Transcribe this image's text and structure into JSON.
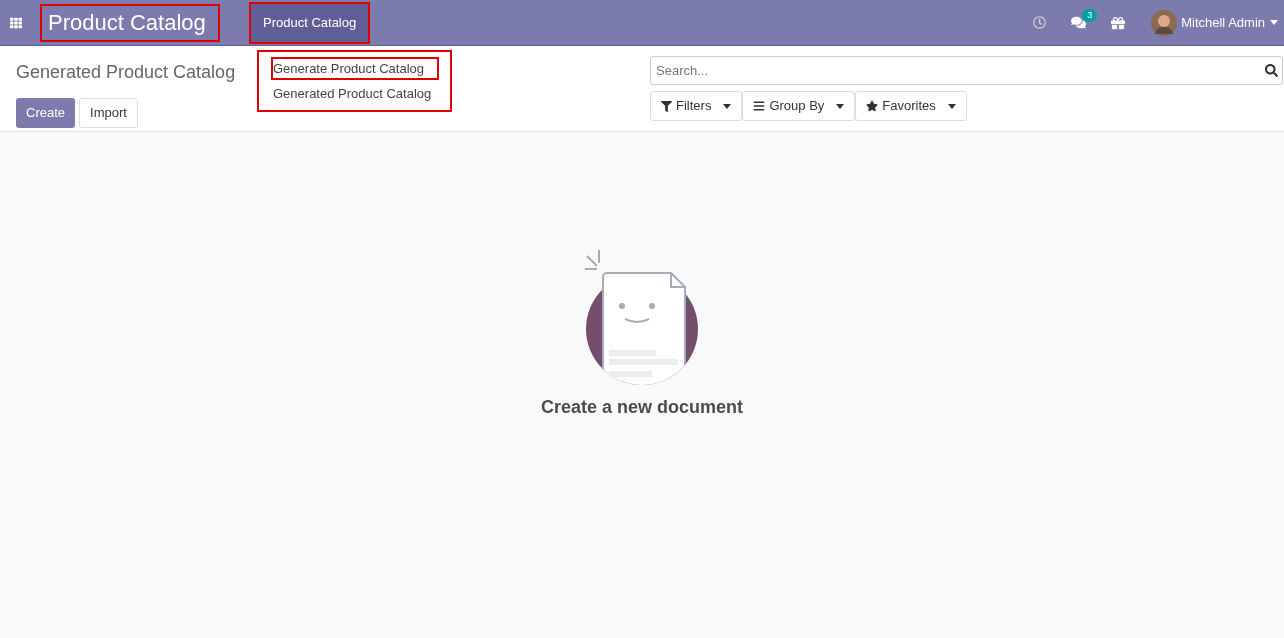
{
  "navbar": {
    "app_title": {
      "text": "Product Catalog",
      "highlighted": true
    },
    "menus": [
      {
        "label": "Product Catalog",
        "open": true,
        "highlighted": true
      }
    ],
    "messages_badge": "3",
    "user": "Mitchell Admin"
  },
  "dropdown": {
    "items": [
      {
        "label": "Generate Product Catalog",
        "highlighted": true
      },
      {
        "label": "Generated Product Catalog",
        "highlighted": false
      }
    ]
  },
  "control_panel": {
    "breadcrumb": "Generated Product Catalog",
    "buttons": [
      {
        "label": "Create",
        "kind": "primary"
      },
      {
        "label": "Import",
        "kind": "secondary"
      }
    ],
    "search": {
      "placeholder": "Search..."
    },
    "filters": [
      {
        "label": "Filters",
        "kind": "filter"
      },
      {
        "label": "Group By",
        "kind": "group"
      },
      {
        "label": "Favorites",
        "kind": "star"
      }
    ]
  },
  "empty_state": {
    "title": "Create a new document"
  }
}
